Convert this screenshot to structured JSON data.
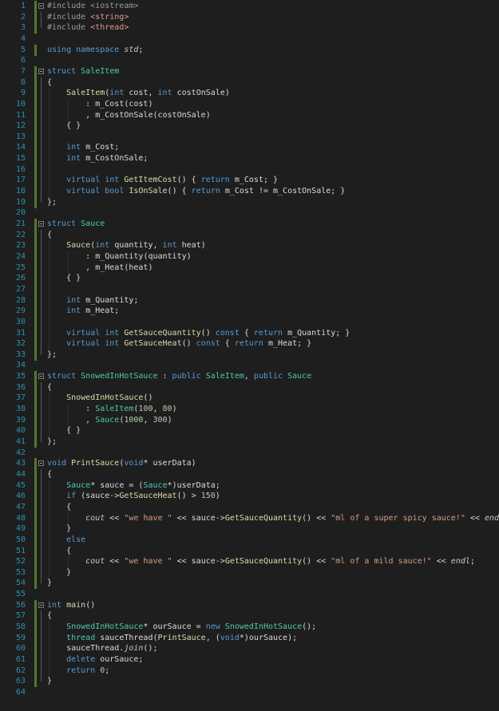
{
  "editor": {
    "language": "C++",
    "lines": [
      {
        "n": "1",
        "tokens": [
          {
            "t": "#include <iostream>",
            "c": "pp"
          }
        ]
      },
      {
        "n": "2",
        "tokens": [
          {
            "t": "#include ",
            "c": "pp"
          },
          {
            "t": "<string>",
            "c": "str"
          }
        ]
      },
      {
        "n": "3",
        "tokens": [
          {
            "t": "#include ",
            "c": "pp"
          },
          {
            "t": "<thread>",
            "c": "str"
          }
        ]
      },
      {
        "n": "4",
        "tokens": []
      },
      {
        "n": "5",
        "tokens": [
          {
            "t": "using namespace ",
            "c": "kw"
          },
          {
            "t": "std",
            "c": "it"
          },
          {
            "t": ";"
          }
        ]
      },
      {
        "n": "6",
        "tokens": []
      },
      {
        "n": "7",
        "tokens": [
          {
            "t": "struct ",
            "c": "kw"
          },
          {
            "t": "SaleItem",
            "c": "ty"
          }
        ]
      },
      {
        "n": "8",
        "tokens": [
          {
            "t": "{"
          }
        ]
      },
      {
        "n": "9",
        "tokens": [
          {
            "t": "    "
          },
          {
            "t": "SaleItem",
            "c": "fn"
          },
          {
            "t": "("
          },
          {
            "t": "int ",
            "c": "kw"
          },
          {
            "t": "cost, "
          },
          {
            "t": "int ",
            "c": "kw"
          },
          {
            "t": "costOnSale)"
          }
        ]
      },
      {
        "n": "10",
        "tokens": [
          {
            "t": "        : "
          },
          {
            "t": "m_Cost",
            "c": "mem"
          },
          {
            "t": "(cost)"
          }
        ]
      },
      {
        "n": "11",
        "tokens": [
          {
            "t": "        , "
          },
          {
            "t": "m_CostOnSale",
            "c": "mem"
          },
          {
            "t": "(costOnSale)"
          }
        ]
      },
      {
        "n": "12",
        "tokens": [
          {
            "t": "    { }"
          }
        ]
      },
      {
        "n": "13",
        "tokens": []
      },
      {
        "n": "14",
        "tokens": [
          {
            "t": "    "
          },
          {
            "t": "int ",
            "c": "kw"
          },
          {
            "t": "m_Cost;"
          }
        ]
      },
      {
        "n": "15",
        "tokens": [
          {
            "t": "    "
          },
          {
            "t": "int ",
            "c": "kw"
          },
          {
            "t": "m_CostOnSale;"
          }
        ]
      },
      {
        "n": "16",
        "tokens": []
      },
      {
        "n": "17",
        "tokens": [
          {
            "t": "    "
          },
          {
            "t": "virtual int ",
            "c": "kw"
          },
          {
            "t": "GetItemCost",
            "c": "fn"
          },
          {
            "t": "() { "
          },
          {
            "t": "return ",
            "c": "kw"
          },
          {
            "t": "m_Cost; }"
          }
        ]
      },
      {
        "n": "18",
        "tokens": [
          {
            "t": "    "
          },
          {
            "t": "virtual bool ",
            "c": "kw"
          },
          {
            "t": "IsOnSale",
            "c": "fn"
          },
          {
            "t": "() { "
          },
          {
            "t": "return ",
            "c": "kw"
          },
          {
            "t": "m_Cost != m_CostOnSale; }"
          }
        ]
      },
      {
        "n": "19",
        "tokens": [
          {
            "t": "};"
          }
        ]
      },
      {
        "n": "20",
        "tokens": []
      },
      {
        "n": "21",
        "tokens": [
          {
            "t": "struct ",
            "c": "kw"
          },
          {
            "t": "Sauce",
            "c": "ty"
          }
        ]
      },
      {
        "n": "22",
        "tokens": [
          {
            "t": "{"
          }
        ]
      },
      {
        "n": "23",
        "tokens": [
          {
            "t": "    "
          },
          {
            "t": "Sauce",
            "c": "fn"
          },
          {
            "t": "("
          },
          {
            "t": "int ",
            "c": "kw"
          },
          {
            "t": "quantity, "
          },
          {
            "t": "int ",
            "c": "kw"
          },
          {
            "t": "heat)"
          }
        ]
      },
      {
        "n": "24",
        "tokens": [
          {
            "t": "        : "
          },
          {
            "t": "m_Quantity",
            "c": "mem"
          },
          {
            "t": "(quantity)"
          }
        ]
      },
      {
        "n": "25",
        "tokens": [
          {
            "t": "        , "
          },
          {
            "t": "m_Heat",
            "c": "mem"
          },
          {
            "t": "(heat)"
          }
        ]
      },
      {
        "n": "26",
        "tokens": [
          {
            "t": "    { }"
          }
        ]
      },
      {
        "n": "27",
        "tokens": []
      },
      {
        "n": "28",
        "tokens": [
          {
            "t": "    "
          },
          {
            "t": "int ",
            "c": "kw"
          },
          {
            "t": "m_Quantity;"
          }
        ]
      },
      {
        "n": "29",
        "tokens": [
          {
            "t": "    "
          },
          {
            "t": "int ",
            "c": "kw"
          },
          {
            "t": "m_Heat;"
          }
        ]
      },
      {
        "n": "30",
        "tokens": []
      },
      {
        "n": "31",
        "tokens": [
          {
            "t": "    "
          },
          {
            "t": "virtual int ",
            "c": "kw"
          },
          {
            "t": "GetSauceQuantity",
            "c": "fn"
          },
          {
            "t": "() "
          },
          {
            "t": "const ",
            "c": "kw"
          },
          {
            "t": "{ "
          },
          {
            "t": "return ",
            "c": "kw"
          },
          {
            "t": "m_Quantity; }"
          }
        ]
      },
      {
        "n": "32",
        "tokens": [
          {
            "t": "    "
          },
          {
            "t": "virtual int ",
            "c": "kw"
          },
          {
            "t": "GetSauceHeat",
            "c": "fn"
          },
          {
            "t": "() "
          },
          {
            "t": "const ",
            "c": "kw"
          },
          {
            "t": "{ "
          },
          {
            "t": "return ",
            "c": "kw"
          },
          {
            "t": "m_Heat; }"
          }
        ]
      },
      {
        "n": "33",
        "tokens": [
          {
            "t": "};"
          }
        ]
      },
      {
        "n": "34",
        "tokens": []
      },
      {
        "n": "35",
        "tokens": [
          {
            "t": "struct ",
            "c": "kw"
          },
          {
            "t": "SnowedInHotSauce",
            "c": "ty"
          },
          {
            "t": " : "
          },
          {
            "t": "public ",
            "c": "kw"
          },
          {
            "t": "SaleItem",
            "c": "ty"
          },
          {
            "t": ", "
          },
          {
            "t": "public ",
            "c": "kw"
          },
          {
            "t": "Sauce",
            "c": "ty"
          }
        ]
      },
      {
        "n": "36",
        "tokens": [
          {
            "t": "{"
          }
        ]
      },
      {
        "n": "37",
        "tokens": [
          {
            "t": "    "
          },
          {
            "t": "SnowedInHotSauce",
            "c": "fn"
          },
          {
            "t": "()"
          }
        ]
      },
      {
        "n": "38",
        "tokens": [
          {
            "t": "        : "
          },
          {
            "t": "SaleItem",
            "c": "ty"
          },
          {
            "t": "("
          },
          {
            "t": "100",
            "c": "num"
          },
          {
            "t": ", "
          },
          {
            "t": "80",
            "c": "num"
          },
          {
            "t": ")"
          }
        ]
      },
      {
        "n": "39",
        "tokens": [
          {
            "t": "        , "
          },
          {
            "t": "Sauce",
            "c": "ty"
          },
          {
            "t": "("
          },
          {
            "t": "1000",
            "c": "num"
          },
          {
            "t": ", "
          },
          {
            "t": "300",
            "c": "num"
          },
          {
            "t": ")"
          }
        ]
      },
      {
        "n": "40",
        "tokens": [
          {
            "t": "    { }"
          }
        ]
      },
      {
        "n": "41",
        "tokens": [
          {
            "t": "};"
          }
        ]
      },
      {
        "n": "42",
        "tokens": []
      },
      {
        "n": "43",
        "tokens": [
          {
            "t": "void ",
            "c": "kw"
          },
          {
            "t": "PrintSauce",
            "c": "fn"
          },
          {
            "t": "("
          },
          {
            "t": "void",
            "c": "kw"
          },
          {
            "t": "* userData)"
          }
        ]
      },
      {
        "n": "44",
        "tokens": [
          {
            "t": "{"
          }
        ]
      },
      {
        "n": "45",
        "tokens": [
          {
            "t": "    "
          },
          {
            "t": "Sauce",
            "c": "ty"
          },
          {
            "t": "* sauce = ("
          },
          {
            "t": "Sauce",
            "c": "ty"
          },
          {
            "t": "*)userData;"
          }
        ]
      },
      {
        "n": "46",
        "tokens": [
          {
            "t": "    "
          },
          {
            "t": "if ",
            "c": "kw"
          },
          {
            "t": "(sauce->"
          },
          {
            "t": "GetSauceHeat",
            "c": "fn"
          },
          {
            "t": "() > "
          },
          {
            "t": "150",
            "c": "num"
          },
          {
            "t": ")"
          }
        ]
      },
      {
        "n": "47",
        "tokens": [
          {
            "t": "    {"
          }
        ]
      },
      {
        "n": "48",
        "tokens": [
          {
            "t": "        "
          },
          {
            "t": "cout",
            "c": "it"
          },
          {
            "t": " << "
          },
          {
            "t": "\"we have \"",
            "c": "str"
          },
          {
            "t": " << sauce->"
          },
          {
            "t": "GetSauceQuantity",
            "c": "fn"
          },
          {
            "t": "() << "
          },
          {
            "t": "\"ml of a super spicy sauce!\"",
            "c": "str"
          },
          {
            "t": " << "
          },
          {
            "t": "endl",
            "c": "it"
          },
          {
            "t": ";"
          }
        ]
      },
      {
        "n": "49",
        "tokens": [
          {
            "t": "    }"
          }
        ]
      },
      {
        "n": "50",
        "tokens": [
          {
            "t": "    "
          },
          {
            "t": "else",
            "c": "kw"
          }
        ]
      },
      {
        "n": "51",
        "tokens": [
          {
            "t": "    {"
          }
        ]
      },
      {
        "n": "52",
        "tokens": [
          {
            "t": "        "
          },
          {
            "t": "cout",
            "c": "it"
          },
          {
            "t": " << "
          },
          {
            "t": "\"we have \"",
            "c": "str"
          },
          {
            "t": " << sauce->"
          },
          {
            "t": "GetSauceQuantity",
            "c": "fn"
          },
          {
            "t": "() << "
          },
          {
            "t": "\"ml of a mild sauce!\"",
            "c": "str"
          },
          {
            "t": " << "
          },
          {
            "t": "endl",
            "c": "it"
          },
          {
            "t": ";"
          }
        ]
      },
      {
        "n": "53",
        "tokens": [
          {
            "t": "    }"
          }
        ]
      },
      {
        "n": "54",
        "tokens": [
          {
            "t": "}"
          }
        ]
      },
      {
        "n": "55",
        "tokens": []
      },
      {
        "n": "56",
        "tokens": [
          {
            "t": "int ",
            "c": "kw"
          },
          {
            "t": "main",
            "c": "fn"
          },
          {
            "t": "()"
          }
        ]
      },
      {
        "n": "57",
        "tokens": [
          {
            "t": "{"
          }
        ]
      },
      {
        "n": "58",
        "tokens": [
          {
            "t": "    "
          },
          {
            "t": "SnowedInHotSauce",
            "c": "ty"
          },
          {
            "t": "* ourSauce = "
          },
          {
            "t": "new ",
            "c": "kw"
          },
          {
            "t": "SnowedInHotSauce",
            "c": "ty"
          },
          {
            "t": "();"
          }
        ]
      },
      {
        "n": "59",
        "tokens": [
          {
            "t": "    "
          },
          {
            "t": "thread",
            "c": "ty"
          },
          {
            "t": " sauceThread("
          },
          {
            "t": "PrintSauce",
            "c": "fn"
          },
          {
            "t": ", ("
          },
          {
            "t": "void",
            "c": "kw"
          },
          {
            "t": "*)ourSauce);"
          }
        ]
      },
      {
        "n": "60",
        "tokens": [
          {
            "t": "    sauceThread."
          },
          {
            "t": "join",
            "c": "it"
          },
          {
            "t": "();"
          }
        ]
      },
      {
        "n": "61",
        "tokens": [
          {
            "t": "    "
          },
          {
            "t": "delete ",
            "c": "kw"
          },
          {
            "t": "ourSauce;"
          }
        ]
      },
      {
        "n": "62",
        "tokens": [
          {
            "t": "    "
          },
          {
            "t": "return ",
            "c": "kw"
          },
          {
            "t": "0",
            "c": "num"
          },
          {
            "t": ";"
          }
        ]
      },
      {
        "n": "63",
        "tokens": [
          {
            "t": "}"
          }
        ]
      },
      {
        "n": "64",
        "tokens": []
      }
    ],
    "change_markers": [
      [
        1,
        3
      ],
      [
        5,
        5
      ],
      [
        7,
        19
      ],
      [
        21,
        33
      ],
      [
        35,
        41
      ],
      [
        43,
        54
      ],
      [
        56,
        63
      ]
    ],
    "fold_regions": [
      [
        1,
        3
      ],
      [
        7,
        19
      ],
      [
        21,
        33
      ],
      [
        35,
        41
      ],
      [
        43,
        54
      ],
      [
        56,
        63
      ]
    ],
    "colors": {
      "background": "#1e1e1e",
      "line_number": "#2b91af",
      "change_marker": "#4f7a28",
      "keyword": "#569cd6",
      "type": "#4ec9b0",
      "function": "#dcdcaa",
      "string": "#d69d85",
      "number": "#b5cea8"
    }
  }
}
